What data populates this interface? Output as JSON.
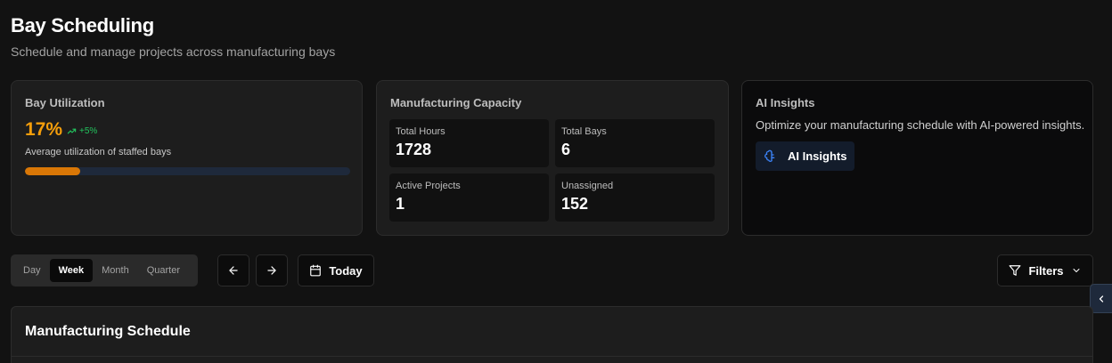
{
  "header": {
    "title": "Bay Scheduling",
    "subtitle": "Schedule and manage projects across manufacturing bays"
  },
  "utilization": {
    "title": "Bay Utilization",
    "value": "17%",
    "trend": "+5%",
    "description": "Average utilization of staffed bays",
    "progress_percent": 17,
    "colors": {
      "value": "#f59e0b",
      "trend": "#22c55e",
      "bar": "#d97706",
      "track": "#1e293b"
    }
  },
  "capacity": {
    "title": "Manufacturing Capacity",
    "stats": [
      {
        "label": "Total Hours",
        "value": "1728"
      },
      {
        "label": "Total Bays",
        "value": "6"
      },
      {
        "label": "Active Projects",
        "value": "1"
      },
      {
        "label": "Unassigned",
        "value": "152"
      }
    ]
  },
  "ai": {
    "title": "AI Insights",
    "description": "Optimize your manufacturing schedule with AI-powered insights.",
    "button_label": "AI Insights",
    "button_icon": "brain-icon"
  },
  "toolbar": {
    "views": [
      {
        "label": "Day",
        "active": false
      },
      {
        "label": "Week",
        "active": true
      },
      {
        "label": "Month",
        "active": false
      },
      {
        "label": "Quarter",
        "active": false
      }
    ],
    "prev_icon": "arrow-left-icon",
    "next_icon": "arrow-right-icon",
    "today_label": "Today",
    "today_icon": "calendar-icon",
    "filters_label": "Filters",
    "filters_icon": "filter-icon"
  },
  "schedule": {
    "title": "Manufacturing Schedule"
  }
}
